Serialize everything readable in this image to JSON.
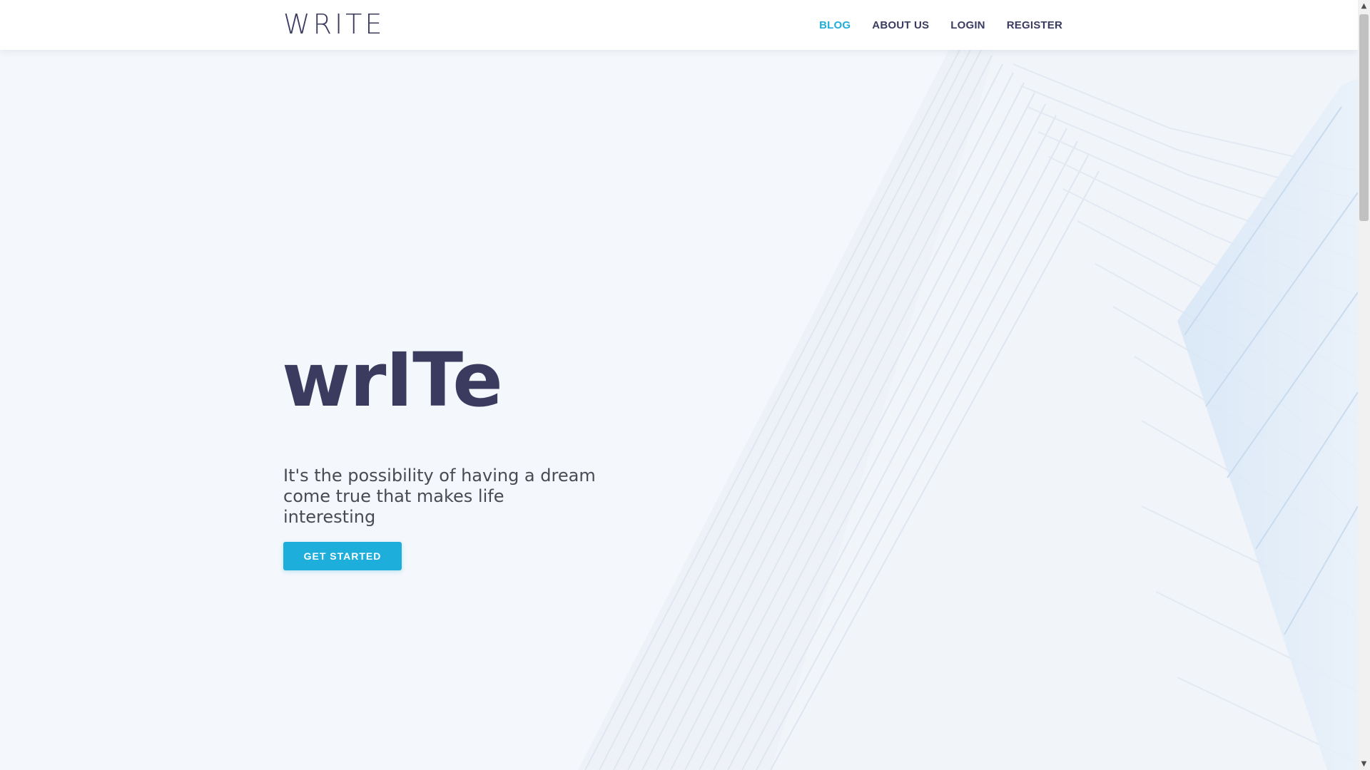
{
  "header": {
    "brand": "WRITE",
    "nav": [
      {
        "label": "BLOG",
        "active": true
      },
      {
        "label": "ABOUT US",
        "active": false
      },
      {
        "label": "LOGIN",
        "active": false
      },
      {
        "label": "REGISTER",
        "active": false
      }
    ]
  },
  "hero": {
    "title": "wrITe",
    "subtitle": "It's the possibility of having a dream come true that makes life interesting",
    "cta_label": "GET STARTED"
  },
  "scrollbar": {
    "up_icon": "chevron-up-icon",
    "down_icon": "chevron-down-icon"
  },
  "colors": {
    "accent": "#1eaedb",
    "brand_text": "#3b3b60",
    "background": "#f4f7fb",
    "header_bg": "#ffffff"
  }
}
